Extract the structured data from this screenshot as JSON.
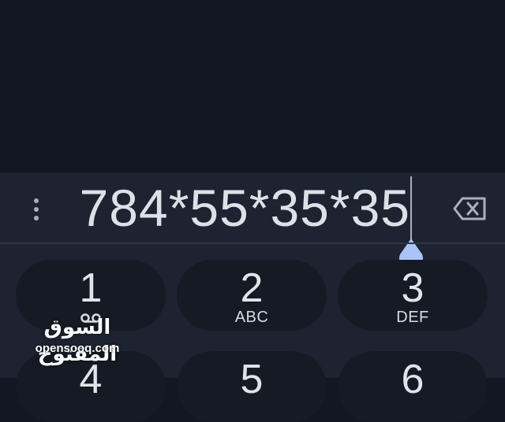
{
  "dialer": {
    "number": "784*55*35*35",
    "keys": [
      {
        "digit": "1",
        "letters": ""
      },
      {
        "digit": "2",
        "letters": "ABC"
      },
      {
        "digit": "3",
        "letters": "DEF"
      },
      {
        "digit": "4",
        "letters": ""
      },
      {
        "digit": "5",
        "letters": ""
      },
      {
        "digit": "6",
        "letters": ""
      }
    ]
  },
  "icons": {
    "more": "more-vertical-icon",
    "backspace": "backspace-icon",
    "voicemail": "voicemail-icon",
    "cursor_handle": "text-cursor-handle-icon"
  },
  "watermark": {
    "arabic": "السوق المفتوح",
    "latin": "opensooq.com"
  },
  "colors": {
    "background": "#121722",
    "panel": "#1d2330",
    "key": "#151a24",
    "text": "#e1e4ea",
    "cursor_handle": "#a9c4f5"
  }
}
